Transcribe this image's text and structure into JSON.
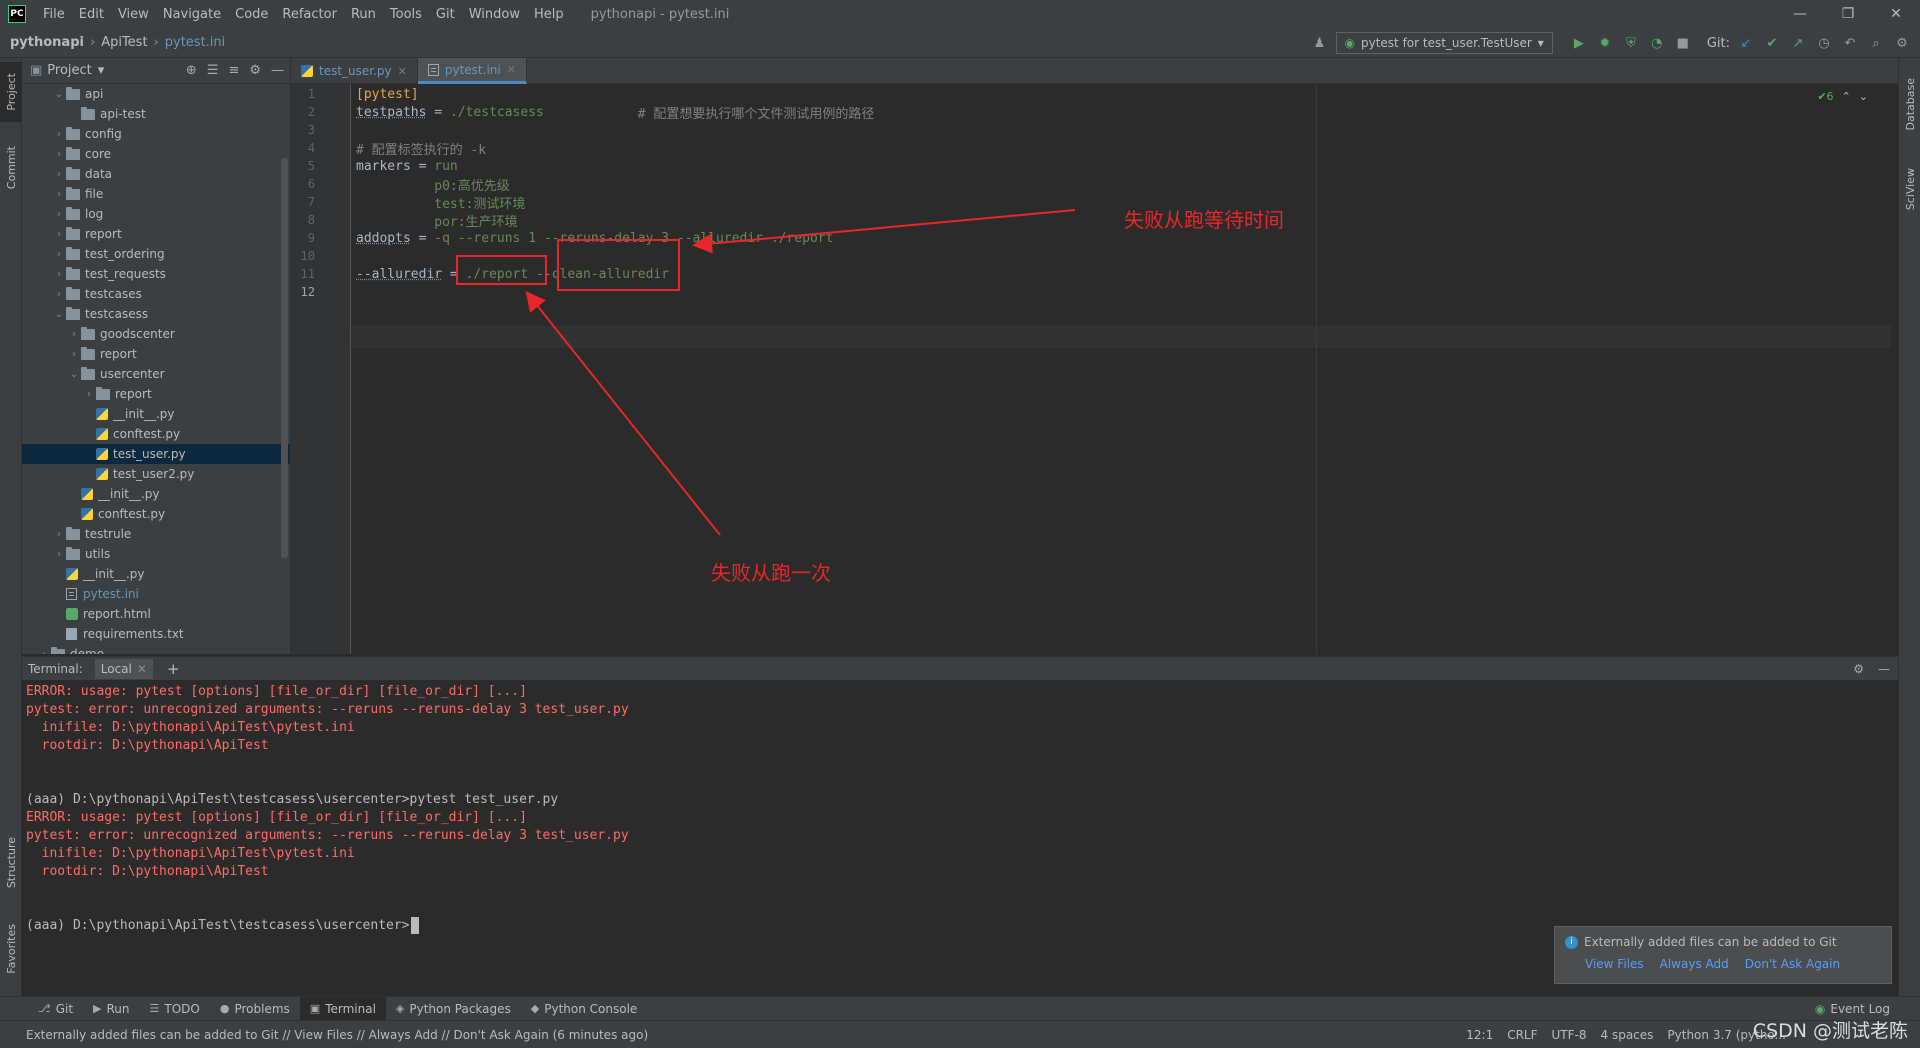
{
  "menubar": {
    "logo": "PC",
    "items": [
      "File",
      "Edit",
      "View",
      "Navigate",
      "Code",
      "Refactor",
      "Run",
      "Tools",
      "Git",
      "Window",
      "Help"
    ],
    "title": "pythonapi - pytest.ini",
    "controls": [
      "—",
      "❐",
      "✕"
    ]
  },
  "navbar": {
    "breadcrumb": [
      "pythonapi",
      "ApiTest",
      "pytest.ini"
    ],
    "run_config": "pytest for test_user.TestUser",
    "git_label": "Git:"
  },
  "left_stripe": [
    "Project",
    "Commit",
    "Structure",
    "Favorites"
  ],
  "right_stripe": [
    "Database",
    "SciView"
  ],
  "project": {
    "title": "Project",
    "tree": [
      {
        "label": "api",
        "indent": 2,
        "type": "folder",
        "arrow": "v"
      },
      {
        "label": "api-test",
        "indent": 3,
        "type": "folder",
        "arrow": ""
      },
      {
        "label": "config",
        "indent": 2,
        "type": "folder",
        "arrow": ">"
      },
      {
        "label": "core",
        "indent": 2,
        "type": "folder",
        "arrow": ">"
      },
      {
        "label": "data",
        "indent": 2,
        "type": "folder",
        "arrow": ">"
      },
      {
        "label": "file",
        "indent": 2,
        "type": "folder",
        "arrow": ">"
      },
      {
        "label": "log",
        "indent": 2,
        "type": "folder",
        "arrow": ">"
      },
      {
        "label": "report",
        "indent": 2,
        "type": "folder",
        "arrow": ">"
      },
      {
        "label": "test_ordering",
        "indent": 2,
        "type": "folder",
        "arrow": ">"
      },
      {
        "label": "test_requests",
        "indent": 2,
        "type": "folder",
        "arrow": ">"
      },
      {
        "label": "testcases",
        "indent": 2,
        "type": "folder",
        "arrow": ">"
      },
      {
        "label": "testcasess",
        "indent": 2,
        "type": "folder",
        "arrow": "v"
      },
      {
        "label": "goodscenter",
        "indent": 3,
        "type": "folder",
        "arrow": ">"
      },
      {
        "label": "report",
        "indent": 3,
        "type": "folder",
        "arrow": ">"
      },
      {
        "label": "usercenter",
        "indent": 3,
        "type": "folder",
        "arrow": "v"
      },
      {
        "label": "report",
        "indent": 4,
        "type": "folder",
        "arrow": ">"
      },
      {
        "label": "__init__.py",
        "indent": 4,
        "type": "py",
        "arrow": ""
      },
      {
        "label": "conftest.py",
        "indent": 4,
        "type": "py",
        "arrow": ""
      },
      {
        "label": "test_user.py",
        "indent": 4,
        "type": "py",
        "arrow": "",
        "selected": true
      },
      {
        "label": "test_user2.py",
        "indent": 4,
        "type": "py",
        "arrow": ""
      },
      {
        "label": "__init__.py",
        "indent": 3,
        "type": "py",
        "arrow": ""
      },
      {
        "label": "conftest.py",
        "indent": 3,
        "type": "py",
        "arrow": ""
      },
      {
        "label": "testrule",
        "indent": 2,
        "type": "folder",
        "arrow": ">"
      },
      {
        "label": "utils",
        "indent": 2,
        "type": "folder",
        "arrow": ">"
      },
      {
        "label": "__init__.py",
        "indent": 2,
        "type": "py",
        "arrow": ""
      },
      {
        "label": "pytest.ini",
        "indent": 2,
        "type": "ini",
        "arrow": "",
        "blue": true
      },
      {
        "label": "report.html",
        "indent": 2,
        "type": "html",
        "arrow": ""
      },
      {
        "label": "requirements.txt",
        "indent": 2,
        "type": "txt",
        "arrow": ""
      },
      {
        "label": "demo",
        "indent": 1,
        "type": "folder",
        "arrow": ">"
      }
    ]
  },
  "editor": {
    "tabs": [
      {
        "label": "test_user.py",
        "active": false
      },
      {
        "label": "pytest.ini",
        "active": true
      }
    ],
    "inspection": "✔6",
    "lines": [
      {
        "n": "1",
        "parts": [
          {
            "t": "[pytest]",
            "c": "sec"
          }
        ]
      },
      {
        "n": "2",
        "parts": [
          {
            "t": "testpaths",
            "c": "k"
          },
          {
            "t": " = ",
            "c": "eq"
          },
          {
            "t": "./testcasess",
            "c": "val"
          },
          {
            "t": "            # 配置想要执行哪个文件测试用例的路径",
            "c": "cmt"
          }
        ]
      },
      {
        "n": "3",
        "parts": []
      },
      {
        "n": "4",
        "parts": [
          {
            "t": "# 配置标签执行的 -k",
            "c": "cmt"
          }
        ]
      },
      {
        "n": "5",
        "parts": [
          {
            "t": "markers",
            "c": "eq"
          },
          {
            "t": " = ",
            "c": "eq"
          },
          {
            "t": "run",
            "c": "val"
          }
        ]
      },
      {
        "n": "6",
        "parts": [
          {
            "t": "          p0:高优先级",
            "c": "val"
          }
        ]
      },
      {
        "n": "7",
        "parts": [
          {
            "t": "          test:测试环境",
            "c": "val"
          }
        ]
      },
      {
        "n": "8",
        "parts": [
          {
            "t": "          por:生产环境",
            "c": "val"
          }
        ]
      },
      {
        "n": "9",
        "parts": [
          {
            "t": "addopts",
            "c": "k"
          },
          {
            "t": " = ",
            "c": "eq"
          },
          {
            "t": "-q --reruns 1 --reruns-delay 3 --alluredir ./report",
            "c": "val"
          }
        ]
      },
      {
        "n": "10",
        "parts": []
      },
      {
        "n": "11",
        "parts": [
          {
            "t": "--alluredir",
            "c": "k"
          },
          {
            "t": " = ",
            "c": "eq"
          },
          {
            "t": "./report --clean-alluredir",
            "c": "val"
          }
        ]
      },
      {
        "n": "12",
        "parts": []
      }
    ]
  },
  "annotations": {
    "rerun_delay": "失败从跑等待时间",
    "rerun_once": "失败从跑一次"
  },
  "terminal": {
    "label": "Terminal:",
    "tab": "Local",
    "lines": [
      {
        "t": "ERROR: usage: pytest [options] [file_or_dir] [file_or_dir] [...]",
        "c": "err"
      },
      {
        "t": "pytest: error: unrecognized arguments: --reruns --reruns-delay 3 test_user.py",
        "c": "err"
      },
      {
        "t": "  inifile: D:\\pythonapi\\ApiTest\\pytest.ini",
        "c": "err"
      },
      {
        "t": "  rootdir: D:\\pythonapi\\ApiTest",
        "c": "err"
      },
      {
        "t": "",
        "c": "norm"
      },
      {
        "t": "",
        "c": "norm"
      },
      {
        "t": "(aaa) D:\\pythonapi\\ApiTest\\testcasess\\usercenter>pytest test_user.py",
        "c": "norm"
      },
      {
        "t": "ERROR: usage: pytest [options] [file_or_dir] [file_or_dir] [...]",
        "c": "err"
      },
      {
        "t": "pytest: error: unrecognized arguments: --reruns --reruns-delay 3 test_user.py",
        "c": "err"
      },
      {
        "t": "  inifile: D:\\pythonapi\\ApiTest\\pytest.ini",
        "c": "err"
      },
      {
        "t": "  rootdir: D:\\pythonapi\\ApiTest",
        "c": "err"
      },
      {
        "t": "",
        "c": "norm"
      },
      {
        "t": "",
        "c": "norm"
      },
      {
        "t": "(aaa) D:\\pythonapi\\ApiTest\\testcasess\\usercenter>",
        "c": "norm",
        "cursor": true
      }
    ]
  },
  "notification": {
    "message": "Externally added files can be added to Git",
    "actions": [
      "View Files",
      "Always Add",
      "Don't Ask Again"
    ]
  },
  "tool_tabs": [
    {
      "label": "Git",
      "icon": "⎇"
    },
    {
      "label": "Run",
      "icon": "▶"
    },
    {
      "label": "TODO",
      "icon": "☰"
    },
    {
      "label": "Problems",
      "icon": "●"
    },
    {
      "label": "Terminal",
      "icon": "▣",
      "active": true
    },
    {
      "label": "Python Packages",
      "icon": "◈"
    },
    {
      "label": "Python Console",
      "icon": "◆"
    }
  ],
  "event_log": "Event Log",
  "statusbar": {
    "message": "Externally added files can be added to Git // View Files // Always Add // Don't Ask Again (6 minutes ago)",
    "position": "12:1",
    "line_sep": "CRLF",
    "encoding": "UTF-8",
    "indent": "4 spaces",
    "interpreter": "Python 3.7 (pytho..."
  },
  "watermark": "CSDN @测试老陈"
}
